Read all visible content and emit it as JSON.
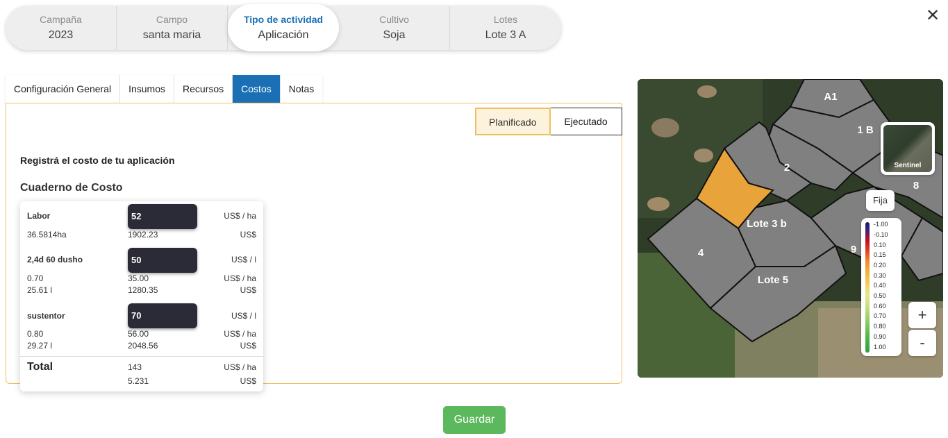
{
  "header": {
    "crumbs": [
      {
        "label": "Campaña",
        "value": "2023"
      },
      {
        "label": "Campo",
        "value": "santa maria"
      },
      {
        "label": "Tipo de actividad",
        "value": "Aplicación"
      },
      {
        "label": "Cultivo",
        "value": "Soja"
      },
      {
        "label": "Lotes",
        "value": "Lote 3 A"
      }
    ],
    "close_icon": "close-icon",
    "close_glyph": "✕"
  },
  "tabs": [
    {
      "label": "Configuración General"
    },
    {
      "label": "Insumos"
    },
    {
      "label": "Recursos"
    },
    {
      "label": "Costos"
    },
    {
      "label": "Notas"
    }
  ],
  "active_tab": "Costos",
  "toggle": {
    "planned": "Planificado",
    "executed": "Ejecutado"
  },
  "subtitle": "Registrá el costo de tu aplicación",
  "section_title": "Cuaderno de Costo",
  "cost_items": [
    {
      "name": "Labor",
      "input": "52",
      "unit": "US$ / ha",
      "area": "36.5814ha",
      "total": "1902.23",
      "total_unit": "US$"
    },
    {
      "name": "2,4d 60 dusho",
      "input": "50",
      "unit": "US$ / l",
      "dose": "0.70",
      "per_ha": "35.00",
      "per_ha_unit": "US$ / ha",
      "qty": "25.61 l",
      "total": "1280.35",
      "total_unit": "US$"
    },
    {
      "name": "sustentor",
      "input": "70",
      "unit": "US$ / l",
      "dose": "0.80",
      "per_ha": "56.00",
      "per_ha_unit": "US$ / ha",
      "qty": "29.27 l",
      "total": "2048.56",
      "total_unit": "US$"
    }
  ],
  "total": {
    "label": "Total",
    "per_ha": "143",
    "per_ha_unit": "US$ / ha",
    "value": "5.231",
    "value_unit": "US$"
  },
  "map": {
    "lots": [
      "A1",
      "1 B",
      "2",
      "8",
      "Lote 3 b",
      "4",
      "9",
      "Lote 5"
    ],
    "thumbnail_label": "Sentinel",
    "fija_label": "Fija",
    "legend": [
      "-1.00",
      "-0.10",
      "0.10",
      "0.15",
      "0.20",
      "0.30",
      "0.40",
      "0.50",
      "0.60",
      "0.70",
      "0.80",
      "0.90",
      "1.00"
    ],
    "zoom_in": "+",
    "zoom_out": "-"
  },
  "save_label": "Guardar",
  "colors": {
    "accent": "#1a6fb5",
    "save": "#5cb85c",
    "panel_border": "#f0c060",
    "input_bg": "#2b2b37"
  }
}
